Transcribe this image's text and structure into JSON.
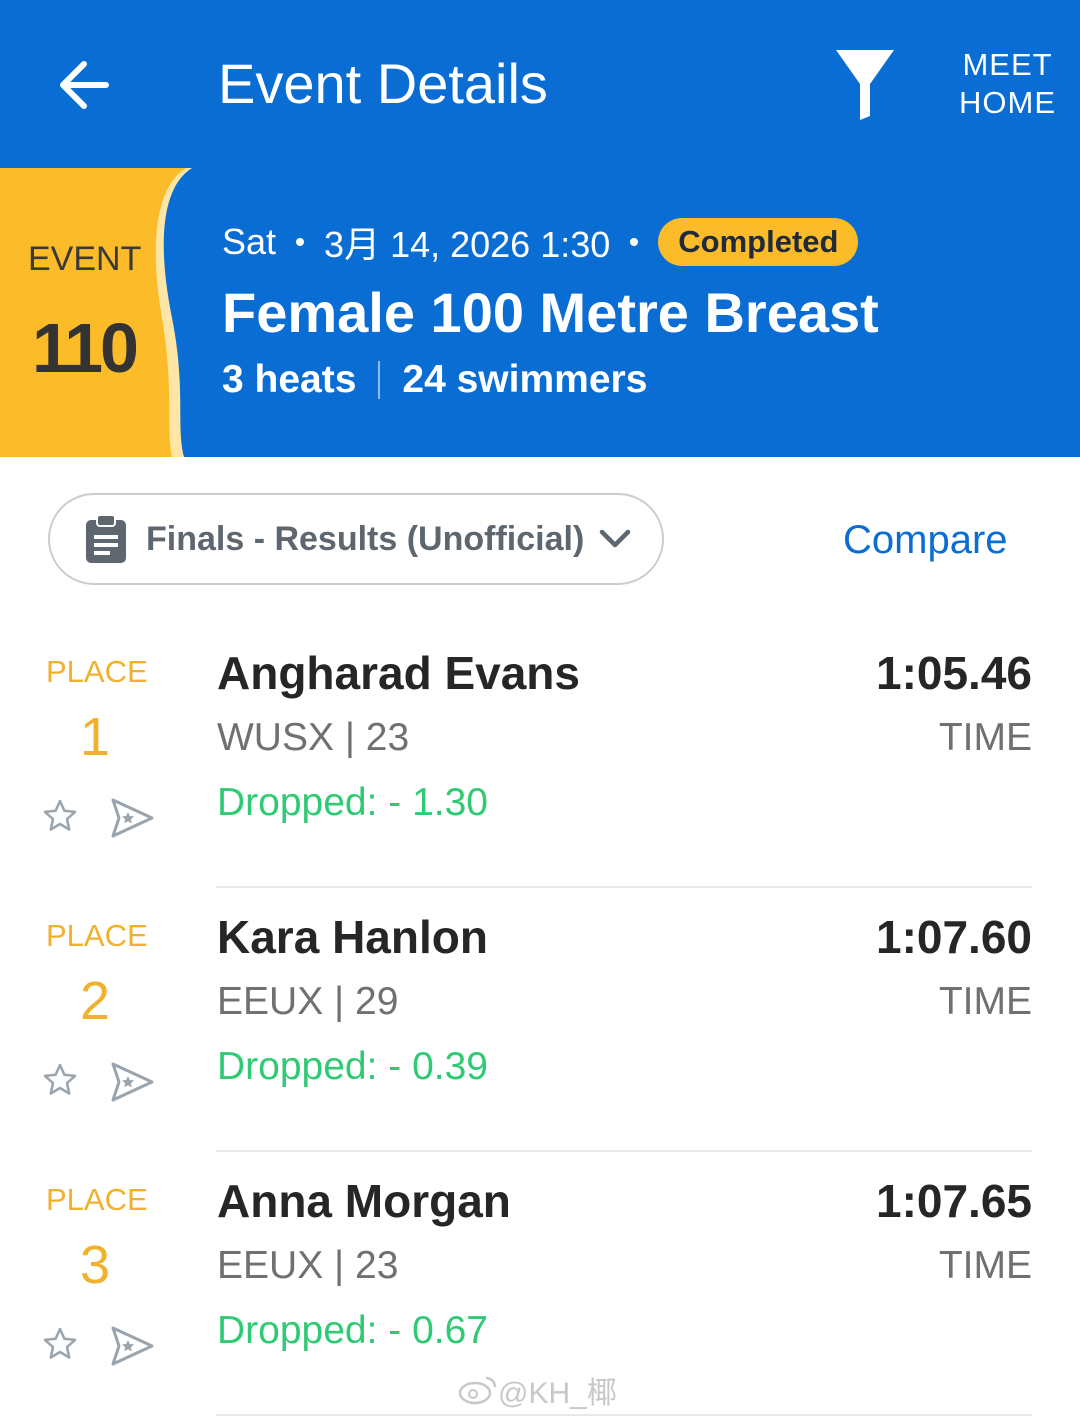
{
  "app_bar": {
    "title": "Event Details",
    "meet_home_label": "MEET HOME",
    "back_icon": "arrow-left-icon",
    "filter_icon": "filter-icon"
  },
  "event": {
    "label": "EVENT",
    "number": "110",
    "day": "Sat",
    "date_time": "3月 14, 2026 1:30",
    "status": "Completed",
    "name": "Female 100 Metre Breast",
    "heats": "3 heats",
    "swimmers": "24 swimmers"
  },
  "round_selector": {
    "icon": "clipboard-icon",
    "selected": "Finals - Results (Unofficial)"
  },
  "compare_label": "Compare",
  "results": [
    {
      "place_label": "PLACE",
      "place": "1",
      "name": "Angharad Evans",
      "team_age": "WUSX | 23",
      "dropped": "Dropped: - 1.30",
      "time": "1:05.46",
      "time_label": "TIME"
    },
    {
      "place_label": "PLACE",
      "place": "2",
      "name": "Kara Hanlon",
      "team_age": "EEUX | 29",
      "dropped": "Dropped: - 0.39",
      "time": "1:07.60",
      "time_label": "TIME"
    },
    {
      "place_label": "PLACE",
      "place": "3",
      "name": "Anna Morgan",
      "team_age": "EEUX | 23",
      "dropped": "Dropped: - 0.67",
      "time": "1:07.65",
      "time_label": "TIME"
    }
  ],
  "watermark": "@KH_椰",
  "colors": {
    "primary_blue": "#0a6dd3",
    "event_tab_yellow": "#fcbc29",
    "place_gold": "#f0b22c",
    "dropped_green": "#2fca74"
  }
}
